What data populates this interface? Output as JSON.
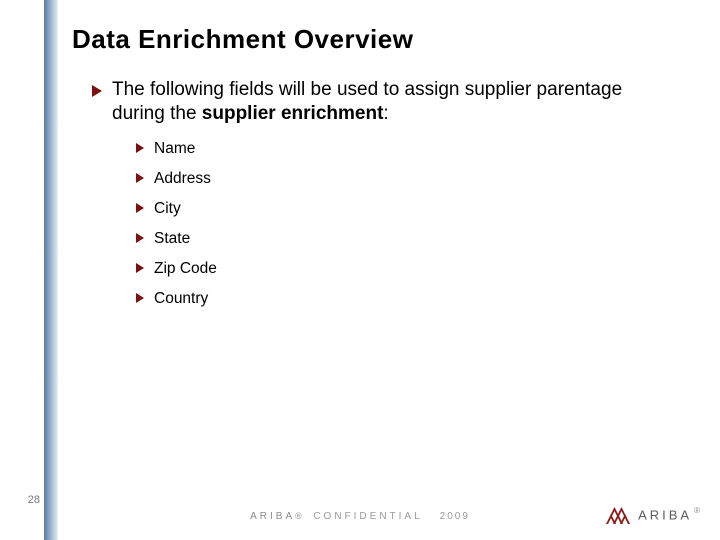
{
  "slide": {
    "title": "Data Enrichment Overview",
    "lead_prefix": "The following fields will be used to assign supplier parentage during the ",
    "lead_bold": "supplier enrichment",
    "lead_suffix": ":",
    "items": [
      "Name",
      "Address",
      "City",
      "State",
      "Zip Code",
      "Country"
    ]
  },
  "footer": {
    "page_number": "28",
    "brand": "ARIBA",
    "reg": "®",
    "confidential": "CONFIDENTIAL",
    "year": "2009"
  },
  "logo": {
    "text": "ARIBA",
    "reg": "®"
  },
  "colors": {
    "bullet": "#7d0f12",
    "logo": "#8d1a18"
  }
}
